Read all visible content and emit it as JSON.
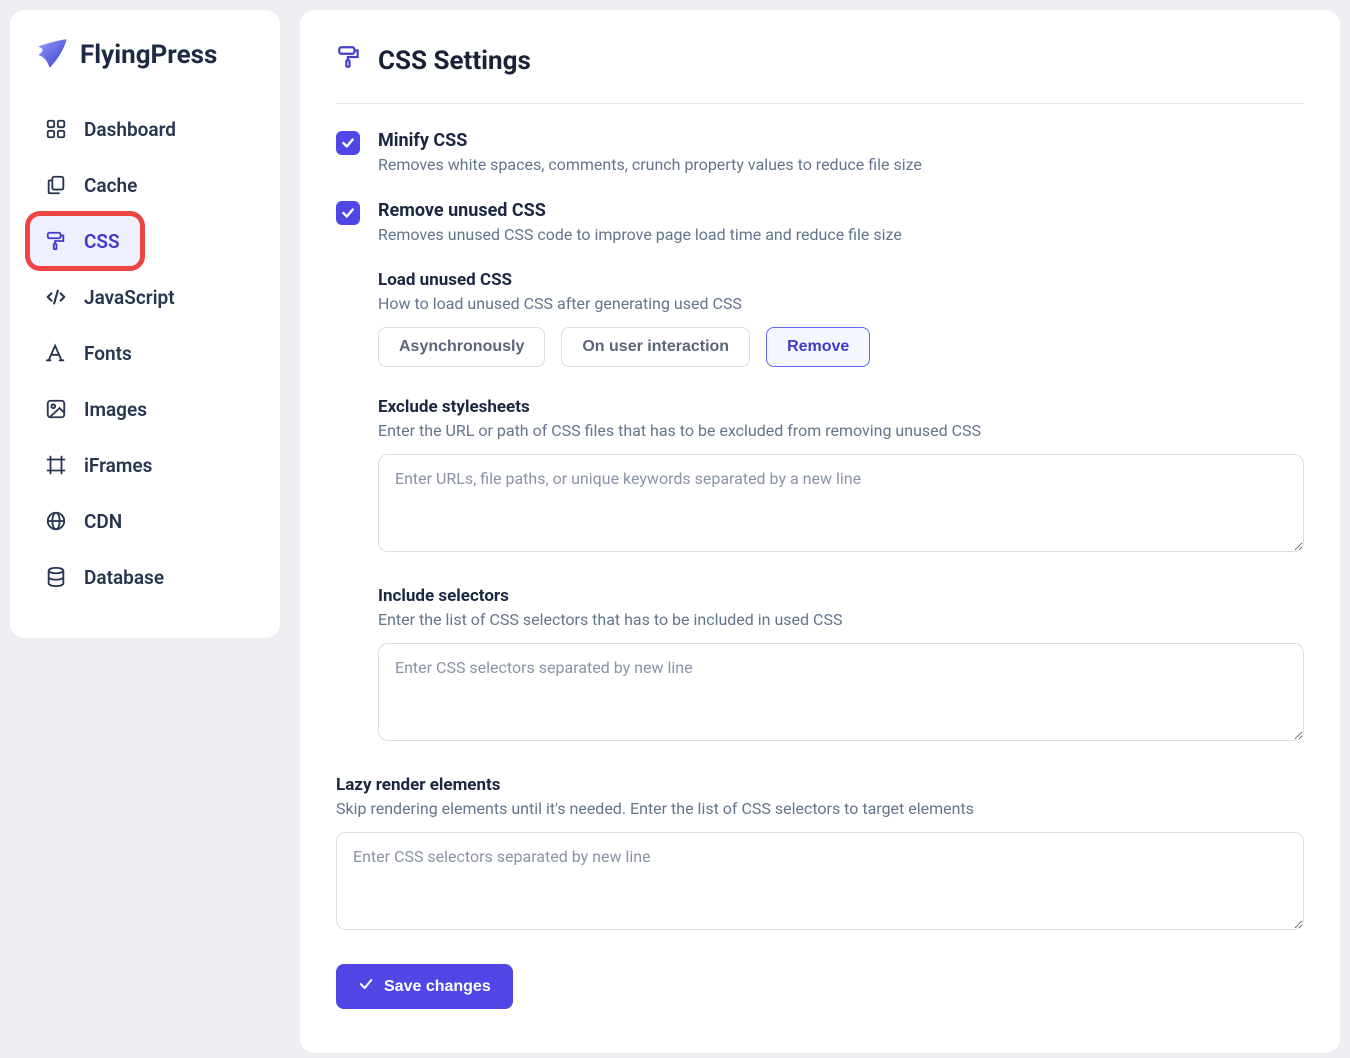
{
  "brand": {
    "name": "FlyingPress"
  },
  "sidebar": {
    "items": [
      {
        "label": "Dashboard"
      },
      {
        "label": "Cache"
      },
      {
        "label": "CSS"
      },
      {
        "label": "JavaScript"
      },
      {
        "label": "Fonts"
      },
      {
        "label": "Images"
      },
      {
        "label": "iFrames"
      },
      {
        "label": "CDN"
      },
      {
        "label": "Database"
      }
    ],
    "active_index": 2,
    "highlighted_index": 2
  },
  "panel": {
    "title": "CSS Settings",
    "minify": {
      "checked": true,
      "title": "Minify CSS",
      "desc": "Removes white spaces, comments, crunch property values to reduce file size"
    },
    "remove_unused": {
      "checked": true,
      "title": "Remove unused CSS",
      "desc": "Removes unused CSS code to improve page load time and reduce file size"
    },
    "load_unused": {
      "title": "Load unused CSS",
      "desc": "How to load unused CSS after generating used CSS",
      "options": [
        "Asynchronously",
        "On user interaction",
        "Remove"
      ],
      "selected_index": 2
    },
    "exclude": {
      "title": "Exclude stylesheets",
      "desc": "Enter the URL or path of CSS files that has to be excluded from removing unused CSS",
      "placeholder": "Enter URLs, file paths, or unique keywords separated by a new line",
      "value": ""
    },
    "include": {
      "title": "Include selectors",
      "desc": "Enter the list of CSS selectors that has to be included in used CSS",
      "placeholder": "Enter CSS selectors separated by new line",
      "value": ""
    },
    "lazy": {
      "title": "Lazy render elements",
      "desc": "Skip rendering elements until it's needed. Enter the list of CSS selectors to target elements",
      "placeholder": "Enter CSS selectors separated by new line",
      "value": ""
    },
    "save_label": "Save changes"
  }
}
